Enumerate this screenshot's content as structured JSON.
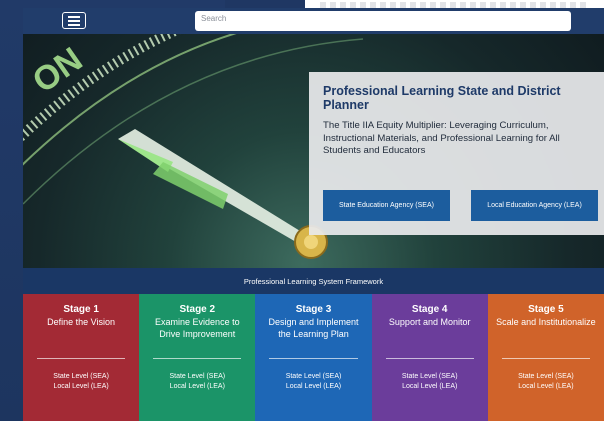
{
  "topbar": {
    "menu_icon": "hamburger-menu-icon",
    "search_placeholder": "Search"
  },
  "hero": {
    "title": "Professional Learning State and District Planner",
    "subtitle": "The Title IIA Equity Multiplier: Leveraging Curriculum, Instructional Materials, and Professional Learning for All Students and Educators",
    "buttons": {
      "sea": "State Education Agency (SEA)",
      "lea": "Local Education Agency (LEA)"
    }
  },
  "framework_label": "Professional Learning System Framework",
  "stages": [
    {
      "number": "Stage 1",
      "name": "Define the Vision",
      "state": "State Level (SEA)",
      "local": "Local Level (LEA)",
      "color": "#a32a35"
    },
    {
      "number": "Stage 2",
      "name": "Examine Evidence to Drive Improvement",
      "state": "State Level (SEA)",
      "local": "Local Level (LEA)",
      "color": "#1b9468"
    },
    {
      "number": "Stage 3",
      "name": "Design and Implement the Learning Plan",
      "state": "State Level (SEA)",
      "local": "Local Level (LEA)",
      "color": "#1e67b6"
    },
    {
      "number": "Stage 4",
      "name": "Support and Monitor",
      "state": "State Level (SEA)",
      "local": "Local Level (LEA)",
      "color": "#6b3d9b"
    },
    {
      "number": "Stage 5",
      "name": "Scale and Institutionalize",
      "state": "State Level (SEA)",
      "local": "Local Level (LEA)",
      "color": "#d0632a"
    }
  ],
  "colors": {
    "navy": "#1e3a68",
    "button_blue": "#1c5d9e"
  }
}
